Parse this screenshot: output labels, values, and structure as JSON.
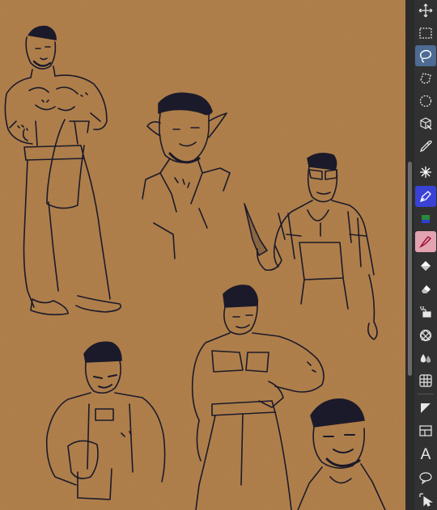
{
  "app": {
    "canvas": {
      "background_color": "#b9864f",
      "ink_color": "#1b1a2a"
    },
    "toolbox": {
      "active_tool": "freehand-selection",
      "tools": [
        {
          "name": "transform",
          "icon": "move-arrows-icon"
        },
        {
          "name": "rectangular-selection",
          "icon": "rect-select-icon"
        },
        {
          "name": "freehand-selection",
          "icon": "lasso-select-icon"
        },
        {
          "name": "polygonal-selection",
          "icon": "polygon-select-icon"
        },
        {
          "name": "elliptical-selection",
          "icon": "ellipse-select-icon"
        },
        {
          "name": "3d-transform",
          "icon": "cube-icon"
        },
        {
          "name": "color-picker",
          "icon": "eyedropper-icon"
        },
        {
          "name": "magic-wand",
          "icon": "magic-wand-icon"
        },
        {
          "name": "pen",
          "icon": "pen-nib-icon"
        },
        {
          "name": "paint-bucket-gradient",
          "icon": "gradient-icon"
        },
        {
          "name": "eraser-brush",
          "icon": "brush-icon"
        },
        {
          "name": "fill",
          "icon": "fill-bucket-icon"
        },
        {
          "name": "eraser",
          "icon": "eraser-icon"
        },
        {
          "name": "blend",
          "icon": "blend-icon"
        },
        {
          "name": "pattern",
          "icon": "pattern-icon"
        },
        {
          "name": "smudge",
          "icon": "drops-icon"
        },
        {
          "name": "grid",
          "icon": "grid-icon"
        },
        {
          "name": "vector",
          "icon": "vector-icon"
        },
        {
          "name": "frame",
          "icon": "frame-icon"
        },
        {
          "name": "text",
          "icon": "text-icon",
          "label": "A"
        },
        {
          "name": "speech-balloon",
          "icon": "speech-bubble-icon"
        },
        {
          "name": "object-select",
          "icon": "object-select-icon"
        }
      ]
    }
  }
}
